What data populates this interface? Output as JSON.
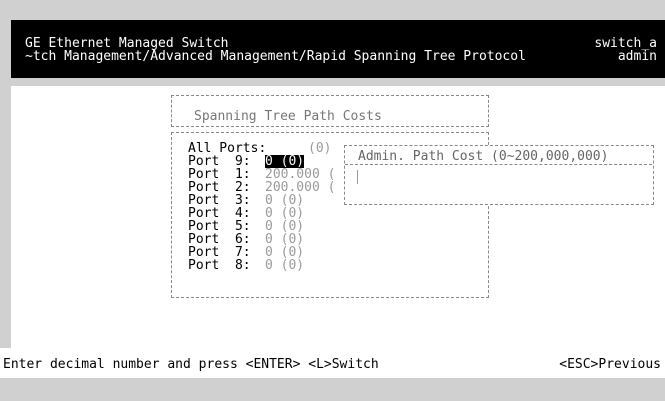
{
  "header": {
    "title": "GE Ethernet Managed Switch",
    "path": "~tch Management/Advanced Management/Rapid Spanning Tree Protocol",
    "hostname": "switch_a",
    "user": "admin"
  },
  "panel": {
    "title": "Spanning Tree Path Costs",
    "all_ports_label": "All Ports:",
    "all_ports_value": "(0)",
    "ports": [
      {
        "label": "Port  9:",
        "value": "0 (0)"
      },
      {
        "label": "Port  1:",
        "value": "200.000 ("
      },
      {
        "label": "Port  2:",
        "value": "200.000 ("
      },
      {
        "label": "Port  3:",
        "value": "0 (0)"
      },
      {
        "label": "Port  4:",
        "value": "0 (0)"
      },
      {
        "label": "Port  5:",
        "value": "0 (0)"
      },
      {
        "label": "Port  6:",
        "value": "0 (0)"
      },
      {
        "label": "Port  7:",
        "value": "0 (0)"
      },
      {
        "label": "Port  8:",
        "value": "0 (0)"
      }
    ]
  },
  "popup": {
    "title": "Admin. Path Cost (0~200,000,000)"
  },
  "status": {
    "hint": "Enter decimal number and press <ENTER> <L>Switch",
    "escape": "<ESC>Previous"
  }
}
